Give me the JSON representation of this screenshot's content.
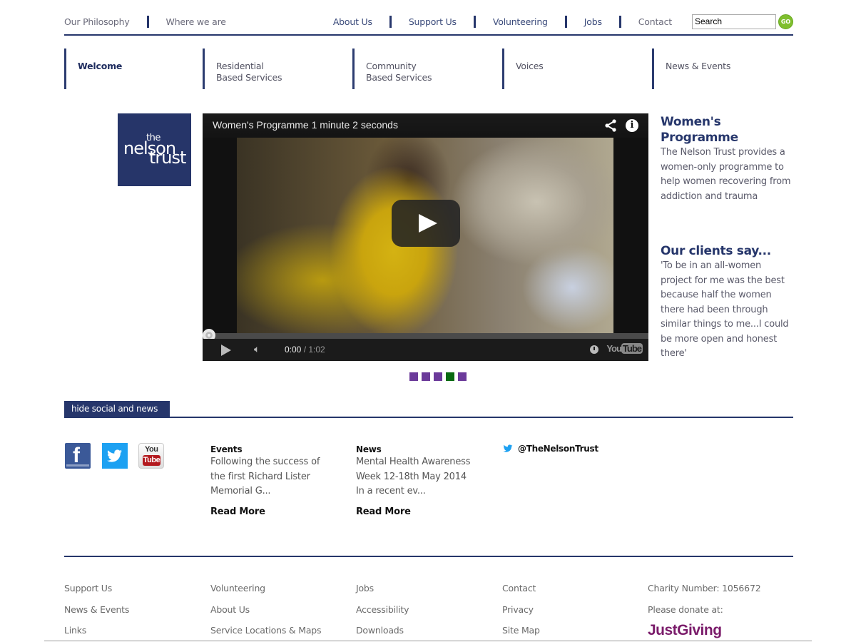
{
  "top_nav": {
    "left_links": [
      "Our Philosophy",
      "Where we are"
    ],
    "right_links": [
      "About Us",
      "Support Us",
      "Volunteering",
      "Jobs",
      "Contact"
    ],
    "search_value": "Search",
    "go_label": "GO"
  },
  "main_nav": [
    {
      "line1": "Welcome",
      "line2": "",
      "active": true
    },
    {
      "line1": "Residential",
      "line2": "Based Services",
      "active": false
    },
    {
      "line1": "Community",
      "line2": "Based Services",
      "active": false
    },
    {
      "line1": "Voices",
      "line2": "",
      "active": false
    },
    {
      "line1": "News & Events",
      "line2": "",
      "active": false
    }
  ],
  "logo": {
    "the": "the",
    "nelson": "nelson",
    "trust": "trust"
  },
  "video": {
    "title": "Women's Programme 1 minute 2 seconds",
    "current_time": "0:00",
    "duration": " / 1:02",
    "progress": 0,
    "yt_you": "You",
    "yt_tube": "Tube"
  },
  "slider": {
    "count": 5,
    "active_index": 3,
    "colors": {
      "inactive": "#6b3a9a",
      "active": "#0a6a12"
    }
  },
  "sidebar": {
    "programme_title": "Women's Programme",
    "programme_text": "The Nelson Trust provides a women-only programme to help women recovering from addiction and trauma",
    "clients_title": "Our clients say...",
    "clients_quote": "'To be in an all-women project for me was the best because half the women there had been through similar things to me...I could be more open and honest there'"
  },
  "social": {
    "toggle_label": "hide social and news",
    "icons": [
      "facebook-icon",
      "twitter-icon",
      "youtube-icon"
    ],
    "yt_you": "You",
    "yt_tube": "Tube"
  },
  "events": {
    "heading": "Events",
    "text": "Following the success of the first Richard Lister Memorial G...",
    "read_more": "Read More"
  },
  "news": {
    "heading": "News",
    "text": "Mental Health Awareness Week 12-18th May 2014 In a recent ev...",
    "read_more": "Read More"
  },
  "twitter": {
    "handle": "@TheNelsonTrust"
  },
  "footer": {
    "col1": [
      "Support Us",
      "News & Events",
      "Links"
    ],
    "col2": [
      "Volunteering",
      "About Us",
      "Service Locations & Maps"
    ],
    "col3": [
      "Jobs",
      "Accessibility",
      "Downloads"
    ],
    "col4": [
      "Contact",
      "Privacy",
      "Site Map"
    ],
    "charity_number": "Charity Number: 1056672",
    "donate_text": "Please donate at:",
    "justgiving": "JustGiving"
  },
  "colors": {
    "brand_navy": "#26366b",
    "go_green": "#7fbf2e",
    "justgiving_purple": "#7a1b6a"
  }
}
